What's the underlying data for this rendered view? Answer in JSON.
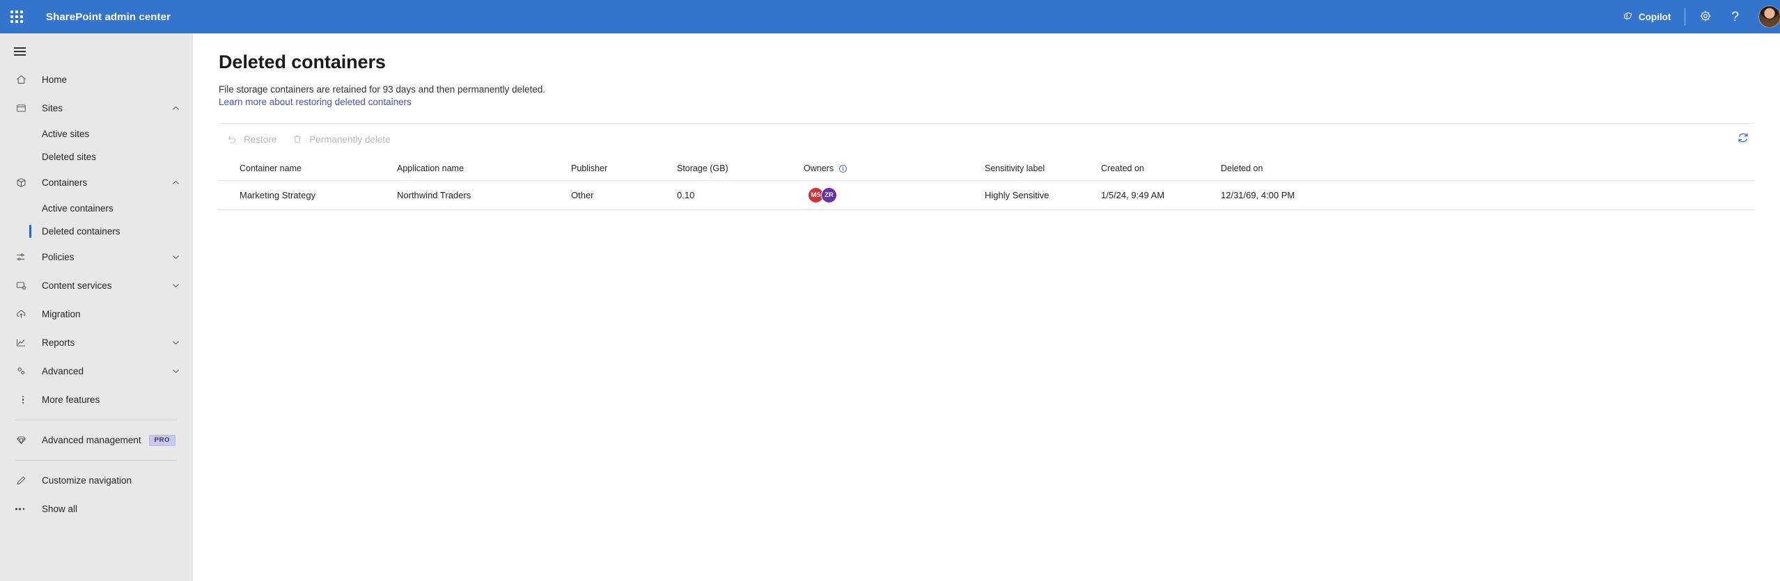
{
  "suite": {
    "waffle_icon": "waffle-grid-icon",
    "title": "SharePoint admin center",
    "copilot_label": "Copilot",
    "copilot_icon": "copilot-icon",
    "settings_icon": "gear-icon",
    "help_icon": "question-mark-icon",
    "avatar_label": "user-avatar",
    "brand_color": "#3375CE"
  },
  "sidebar": {
    "hamburger_icon": "hamburger-menu-icon",
    "background_color": "#E8E8E8",
    "selection_color": "#2266CE",
    "items": [
      {
        "label": "Home",
        "icon": "home-icon",
        "type": "item",
        "chevron": "none"
      },
      {
        "label": "Sites",
        "icon": "sites-icon",
        "type": "item",
        "chevron": "up"
      },
      {
        "label": "Active sites",
        "icon": "",
        "type": "sub",
        "selected": false
      },
      {
        "label": "Deleted sites",
        "icon": "",
        "type": "sub",
        "selected": false
      },
      {
        "label": "Containers",
        "icon": "box-icon",
        "type": "item",
        "chevron": "up"
      },
      {
        "label": "Active containers",
        "icon": "",
        "type": "sub",
        "selected": false
      },
      {
        "label": "Deleted containers",
        "icon": "",
        "type": "sub",
        "selected": true
      },
      {
        "label": "Policies",
        "icon": "sliders-icon",
        "type": "item",
        "chevron": "down"
      },
      {
        "label": "Content services",
        "icon": "content-services-icon",
        "type": "item",
        "chevron": "down"
      },
      {
        "label": "Migration",
        "icon": "cloud-upload-icon",
        "type": "item",
        "chevron": "none"
      },
      {
        "label": "Reports",
        "icon": "chart-line-icon",
        "type": "item",
        "chevron": "down"
      },
      {
        "label": "Advanced",
        "icon": "gears-icon",
        "type": "item",
        "chevron": "down"
      },
      {
        "label": "More features",
        "icon": "vertical-dots-icon",
        "type": "item",
        "chevron": "none"
      },
      {
        "label": "Advanced management",
        "icon": "diamond-icon",
        "type": "item",
        "chevron": "none",
        "badge": "PRO"
      },
      {
        "label": "Customize navigation",
        "icon": "pencil-icon",
        "type": "item",
        "chevron": "none"
      },
      {
        "label": "Show all",
        "icon": "horizontal-dots-icon",
        "type": "item",
        "chevron": "none"
      }
    ]
  },
  "page": {
    "title": "Deleted containers",
    "description": "File storage containers are retained for 93 days and then permanently deleted.",
    "learn_more_link": "Learn more about restoring deleted containers",
    "link_color": "#4f52B2"
  },
  "commandbar": {
    "restore_label": "Restore",
    "restore_icon": "undo-arrow-icon",
    "restore_disabled": true,
    "delete_label": "Permanently delete",
    "delete_icon": "trash-icon",
    "delete_disabled": true,
    "refresh_icon": "refresh-icon",
    "refresh_color": "#3b68d4"
  },
  "table": {
    "columns": [
      {
        "label": "Container name",
        "key": "container_name"
      },
      {
        "label": "Application name",
        "key": "application_name"
      },
      {
        "label": "Publisher",
        "key": "publisher"
      },
      {
        "label": "Storage (GB)",
        "key": "storage_gb"
      },
      {
        "label": "Owners",
        "key": "owners",
        "info_icon": "info-icon"
      },
      {
        "label": "Sensitivity label",
        "key": "sensitivity_label"
      },
      {
        "label": "Created on",
        "key": "created_on"
      },
      {
        "label": "Deleted on",
        "key": "deleted_on"
      }
    ],
    "rows": [
      {
        "container_name": "Marketing Strategy",
        "application_name": "Northwind Traders",
        "publisher": "Other",
        "storage_gb": "0.10",
        "owners": [
          {
            "initials": "MS",
            "color": "#D13438"
          },
          {
            "initials": "ZR",
            "color": "#6B2FA8"
          }
        ],
        "sensitivity_label": "Highly Sensitive",
        "created_on": "1/5/24, 9:49 AM",
        "deleted_on": "12/31/69, 4:00 PM"
      }
    ]
  }
}
